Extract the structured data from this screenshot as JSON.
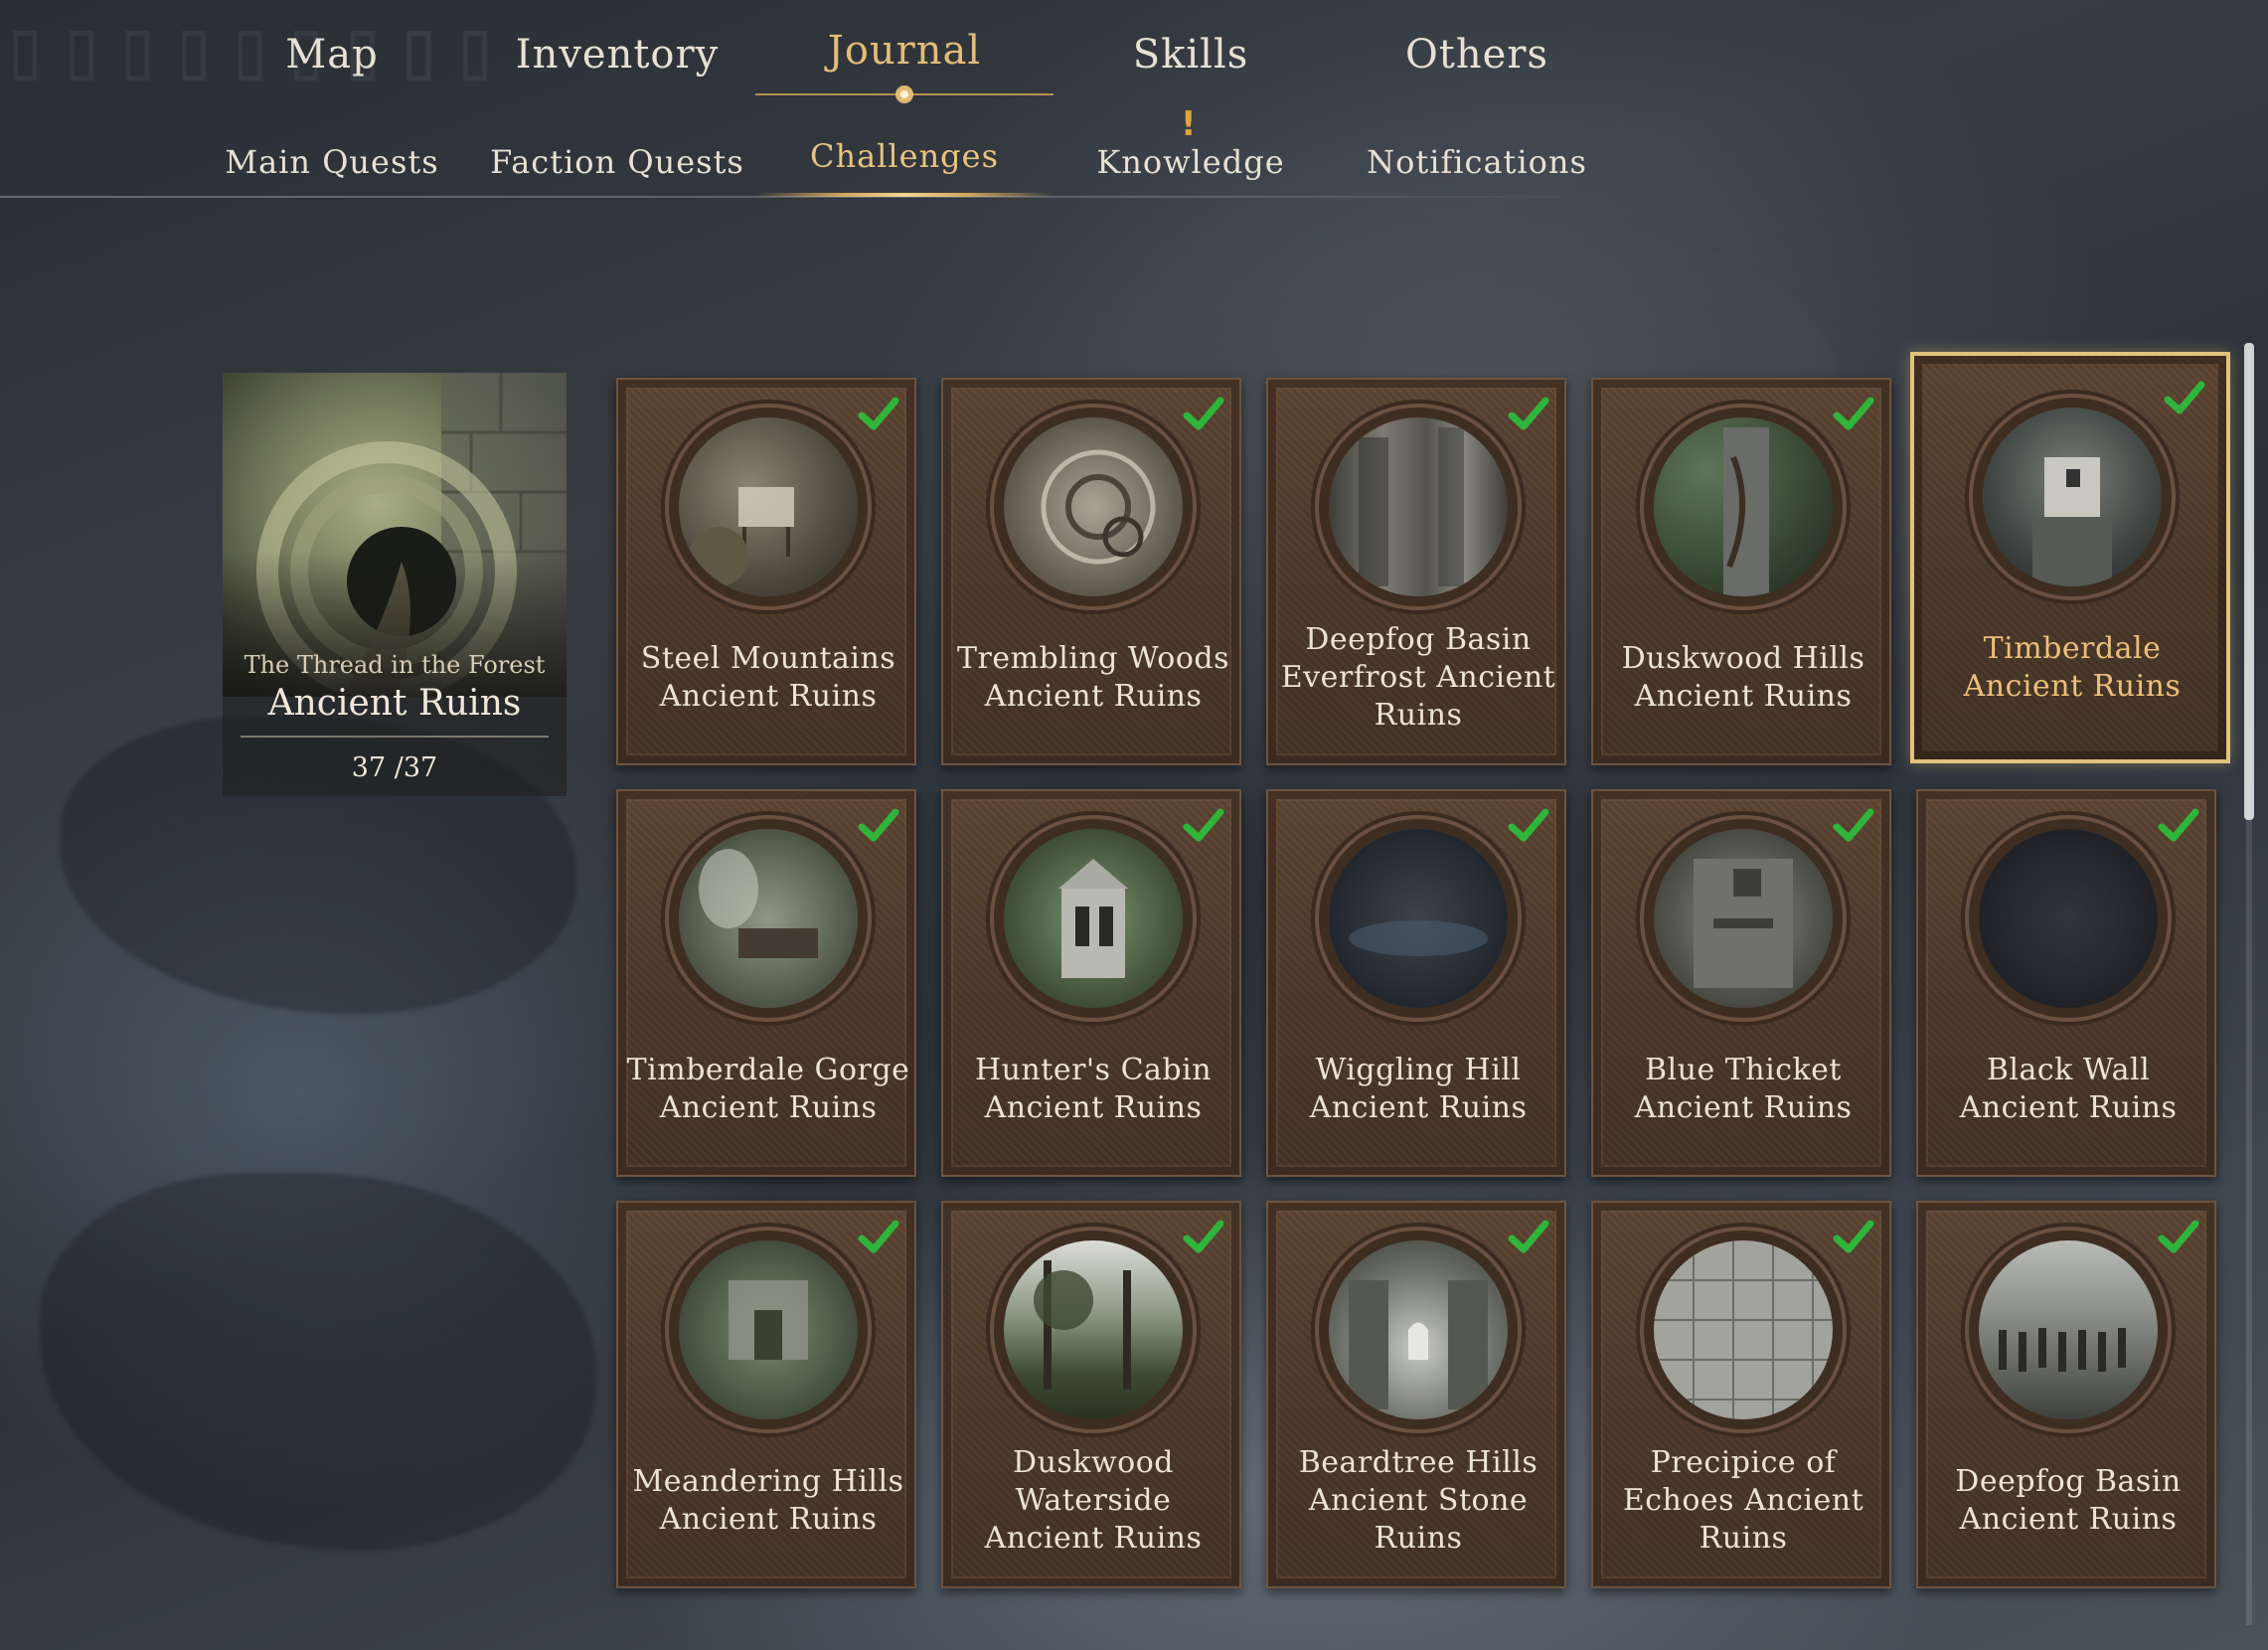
{
  "nav": {
    "top_tabs": [
      "Map",
      "Inventory",
      "Journal",
      "Skills",
      "Others"
    ],
    "active_top_tab": "Journal",
    "sub_tabs": [
      "Main Quests",
      "Faction Quests",
      "Challenges",
      "Knowledge",
      "Notifications"
    ],
    "active_sub_tab": "Challenges",
    "knowledge_alert": "!"
  },
  "summary": {
    "subtitle": "The Thread in the Forest",
    "title": "Ancient Ruins",
    "count": "37 /37"
  },
  "cards": [
    {
      "label": "Steel Mountains Ancient Ruins",
      "completed": true,
      "selected": false
    },
    {
      "label": "Trembling Woods Ancient Ruins",
      "completed": true,
      "selected": false
    },
    {
      "label": "Deepfog Basin Everfrost Ancient Ruins",
      "completed": true,
      "selected": false
    },
    {
      "label": "Duskwood Hills Ancient Ruins",
      "completed": true,
      "selected": false
    },
    {
      "label": "Timberdale Ancient Ruins",
      "completed": true,
      "selected": true
    },
    {
      "label": "Timberdale Gorge Ancient Ruins",
      "completed": true,
      "selected": false
    },
    {
      "label": "Hunter's Cabin Ancient Ruins",
      "completed": true,
      "selected": false
    },
    {
      "label": "Wiggling Hill Ancient Ruins",
      "completed": true,
      "selected": false
    },
    {
      "label": "Blue Thicket Ancient Ruins",
      "completed": true,
      "selected": false
    },
    {
      "label": "Black Wall Ancient Ruins",
      "completed": true,
      "selected": false
    },
    {
      "label": "Meandering Hills Ancient Ruins",
      "completed": true,
      "selected": false
    },
    {
      "label": "Duskwood Waterside Ancient Ruins",
      "completed": true,
      "selected": false
    },
    {
      "label": "Beardtree Hills Ancient Stone Ruins",
      "completed": true,
      "selected": false
    },
    {
      "label": "Precipice of Echoes Ancient Ruins",
      "completed": true,
      "selected": false
    },
    {
      "label": "Deepfog Basin Ancient Ruins",
      "completed": true,
      "selected": false
    }
  ],
  "colors": {
    "accent_gold": "#e3bd77",
    "check_green": "#2fb53a",
    "card_brown": "#4b3829"
  },
  "icons": {
    "check": "checkmark-icon",
    "alert": "exclamation-icon"
  }
}
